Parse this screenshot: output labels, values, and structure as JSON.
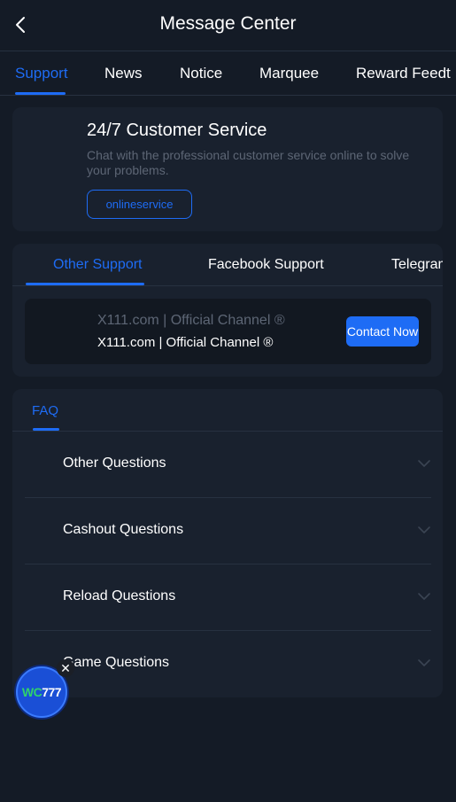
{
  "header": {
    "title": "Message Center",
    "back_icon": "chevron-left-icon"
  },
  "top_tabs": [
    {
      "label": "Support",
      "active": true
    },
    {
      "label": "News",
      "active": false
    },
    {
      "label": "Notice",
      "active": false
    },
    {
      "label": "Marquee",
      "active": false
    },
    {
      "label": "Reward Feedt",
      "active": false
    }
  ],
  "customer_service": {
    "title": "24/7 Customer Service",
    "description": "Chat with the professional customer service online to solve your problems.",
    "button_label": "onlineservice"
  },
  "support": {
    "tabs": [
      {
        "label": "Other Support",
        "active": true
      },
      {
        "label": "Facebook Support",
        "active": false
      },
      {
        "label": "Telegram",
        "active": false
      }
    ],
    "channel": {
      "name_dim": "X111.com | Official Channel ®",
      "name": "X111.com | Official Channel ®",
      "button_label": "Contact Now"
    }
  },
  "faq": {
    "tab_label": "FAQ",
    "items": [
      {
        "label": "Other Questions"
      },
      {
        "label": "Cashout Questions"
      },
      {
        "label": "Reload Questions"
      },
      {
        "label": "Game Questions"
      }
    ]
  },
  "floating_widget": {
    "logo_green": "WC",
    "logo_white": "777",
    "close_glyph": "✕"
  },
  "colors": {
    "background": "#141b26",
    "card": "#19212e",
    "accent": "#1e6cf5",
    "muted_text": "#5d6675"
  }
}
